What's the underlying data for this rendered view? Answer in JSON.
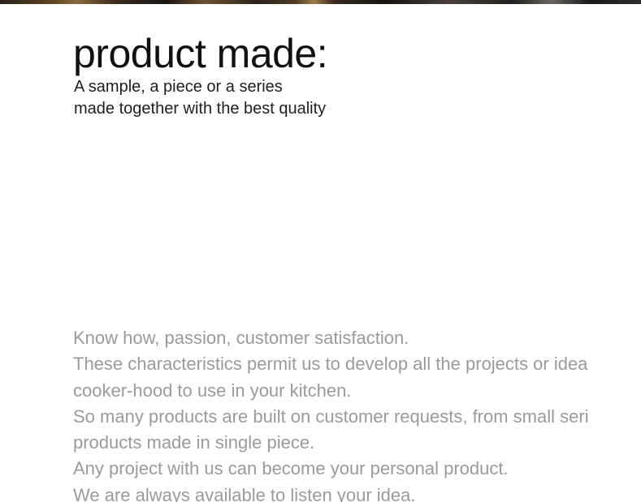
{
  "header": {
    "title": "product made:",
    "subtitle_lines": [
      "A sample, a piece or a series",
      "made together with the best quality"
    ]
  },
  "body": {
    "lines": [
      "Know how, passion, customer satisfaction.",
      "These characteristics permit us to develop all the projects or idea",
      "cooker-hood to use in your kitchen.",
      "So many products are built on customer requests, from small seri",
      "products made in single piece.",
      "Any project with us can become your personal product.",
      "We are always available to listen your idea."
    ]
  },
  "colors": {
    "title": "#111111",
    "subtitle": "#1e1e1e",
    "body": "#9a9a9a",
    "background": "#ffffff"
  }
}
